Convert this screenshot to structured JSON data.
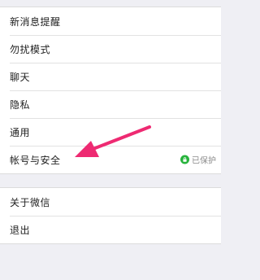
{
  "settings": {
    "group1": [
      {
        "label": "新消息提醒"
      },
      {
        "label": "勿扰模式"
      },
      {
        "label": "聊天"
      },
      {
        "label": "隐私"
      },
      {
        "label": "通用"
      },
      {
        "label": "帐号与安全",
        "status": "已保护",
        "status_icon": "lock-icon",
        "status_color": "#27b33c"
      }
    ],
    "group2": [
      {
        "label": "关于微信"
      },
      {
        "label": "退出"
      }
    ]
  },
  "annotation": {
    "arrow_color": "#ee2a72",
    "target": "帐号与安全"
  }
}
